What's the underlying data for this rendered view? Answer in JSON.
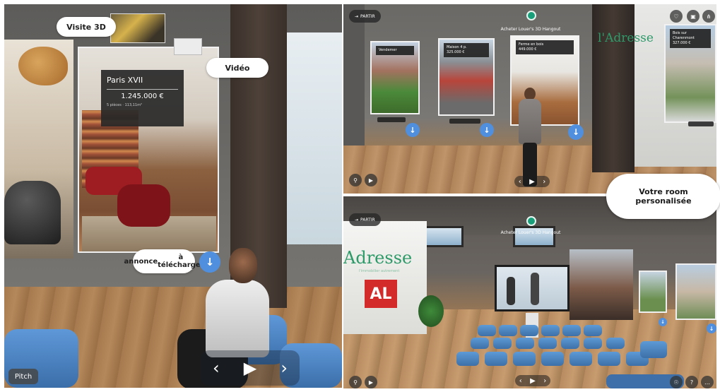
{
  "left_panel": {
    "visite_button": "Visite 3D",
    "video_button": "Vidéo",
    "annonce_button_line1": "annonce",
    "annonce_button_line2": "à télécharger",
    "pitch_label": "Pitch",
    "listing": {
      "city": "Paris XVII",
      "price": "1.245.000 €",
      "meta": "5 pièces · 113,11m²"
    },
    "nav": {
      "prev": "‹",
      "play": "▶",
      "next": "›"
    },
    "download_icon": "download-arrow"
  },
  "right_top": {
    "leave_label": "PARTIR",
    "room_title": "Acheter Louer's 3D Hangout",
    "brand": "l'Adresse",
    "cards": [
      {
        "title": "Vendemer",
        "price": "—"
      },
      {
        "title": "Maison 4 p.",
        "price": "325.000 €"
      },
      {
        "title": "Ferme en bois",
        "price": "449.000 €"
      },
      {
        "title": "Bois sur Charenmont",
        "price": "327.000 €"
      }
    ],
    "nav": {
      "prev": "‹",
      "play": "▶",
      "next": "›"
    }
  },
  "cta": {
    "line1": "Votre room",
    "line2": "personalisée"
  },
  "right_bottom": {
    "leave_label": "PARTIR",
    "room_title": "Acheter Louer's 3D Hangout",
    "brand": "Adresse",
    "brand_sub": "l'immobilier autrement",
    "al_logo": "AL",
    "nav": {
      "prev": "‹",
      "play": "▶",
      "next": "›"
    }
  },
  "colors": {
    "accent_blue": "#4f8fde",
    "brand_green": "#2e9a6a",
    "al_red": "#d32a2a"
  }
}
